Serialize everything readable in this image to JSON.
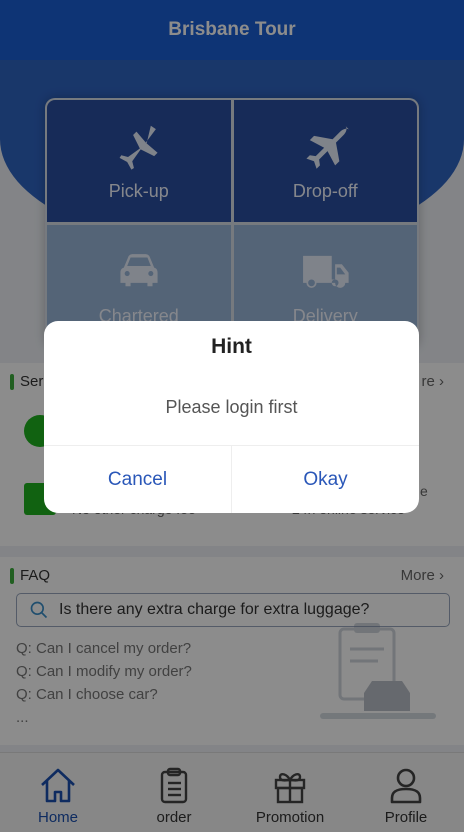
{
  "header": {
    "title": "Brisbane Tour"
  },
  "services": [
    {
      "label": "Pick-up",
      "icon": "plane-landing-icon"
    },
    {
      "label": "Drop-off",
      "icon": "plane-takeoff-icon"
    },
    {
      "label": "Chartered",
      "icon": "car-icon"
    },
    {
      "label": "Delivery",
      "icon": "truck-icon"
    }
  ],
  "service_section": {
    "title_fragment": "Ser",
    "more_fragment": "re",
    "item_sub_left": "No other charge fee",
    "item_sub_right": "24h online service",
    "item_right_fragment": "e"
  },
  "faq": {
    "title": "FAQ",
    "more": "More",
    "search_text": "Is there any extra charge for extra luggage?",
    "questions": [
      "Q: Can I cancel my order?",
      "Q: Can I modify my order?",
      "Q: Can I choose car?",
      "..."
    ]
  },
  "tabbar": [
    {
      "label": "Home",
      "icon": "home-icon",
      "active": true
    },
    {
      "label": "order",
      "icon": "clipboard-icon",
      "active": false
    },
    {
      "label": "Promotion",
      "icon": "gift-icon",
      "active": false
    },
    {
      "label": "Profile",
      "icon": "user-icon",
      "active": false
    }
  ],
  "dialog": {
    "title": "Hint",
    "message": "Please login first",
    "cancel": "Cancel",
    "okay": "Okay"
  },
  "colors": {
    "brand_blue": "#1a5fd6",
    "accent_green": "#3cae3c",
    "dialog_button": "#2a57b8"
  }
}
